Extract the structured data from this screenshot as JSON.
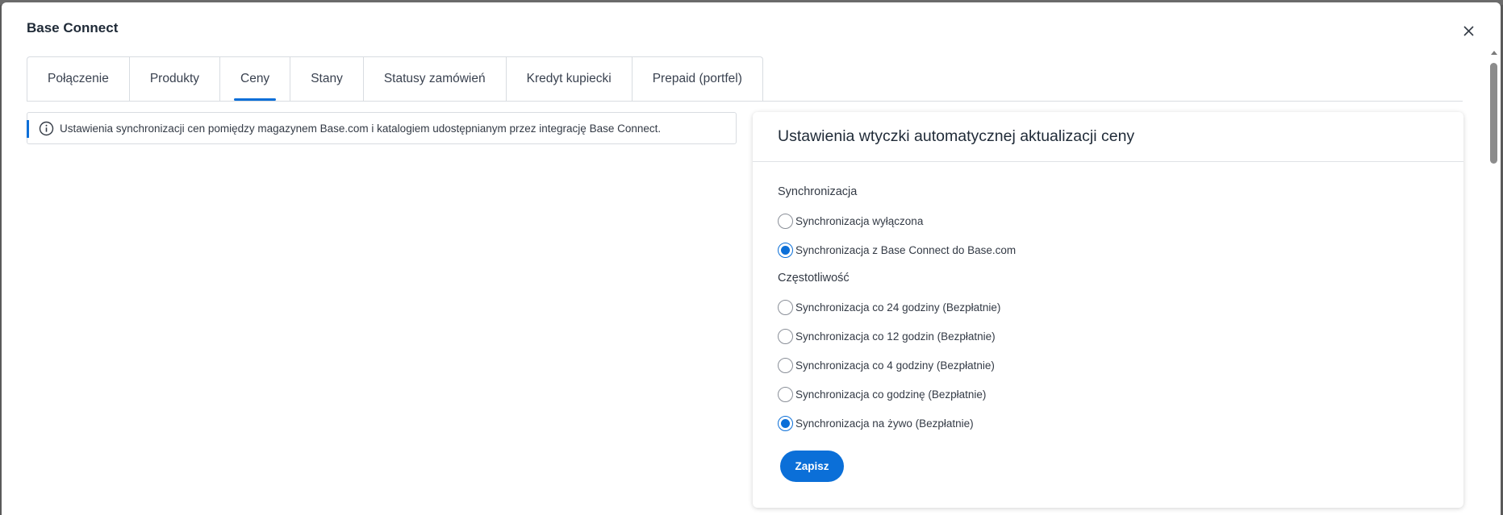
{
  "modal": {
    "title": "Base Connect",
    "close_icon": "close-icon"
  },
  "tabs": [
    {
      "label": "Połączenie",
      "active": false
    },
    {
      "label": "Produkty",
      "active": false
    },
    {
      "label": "Ceny",
      "active": true
    },
    {
      "label": "Stany",
      "active": false
    },
    {
      "label": "Statusy zamówień",
      "active": false
    },
    {
      "label": "Kredyt kupiecki",
      "active": false
    },
    {
      "label": "Prepaid (portfel)",
      "active": false
    }
  ],
  "info": {
    "icon": "info-icon",
    "text": "Ustawienia synchronizacji cen pomiędzy magazynem Base.com i katalogiem udostępnianym przez integrację Base Connect."
  },
  "card": {
    "title": "Ustawienia wtyczki automatycznej aktualizacji ceny",
    "sync_section": {
      "label": "Synchronizacja",
      "options": [
        {
          "label": "Synchronizacja wyłączona",
          "checked": false
        },
        {
          "label": "Synchronizacja z Base Connect do Base.com",
          "checked": true
        }
      ]
    },
    "frequency_section": {
      "label": "Częstotliwość",
      "options": [
        {
          "label": "Synchronizacja co 24 godziny (Bezpłatnie)",
          "checked": false
        },
        {
          "label": "Synchronizacja co 12 godzin (Bezpłatnie)",
          "checked": false
        },
        {
          "label": "Synchronizacja co 4 godziny (Bezpłatnie)",
          "checked": false
        },
        {
          "label": "Synchronizacja co godzinę (Bezpłatnie)",
          "checked": false
        },
        {
          "label": "Synchronizacja na żywo (Bezpłatnie)",
          "checked": true
        }
      ]
    },
    "save_label": "Zapisz"
  },
  "colors": {
    "accent": "#0b6fd8",
    "border": "#d8dce1",
    "backdrop": "#5a5a5a"
  }
}
